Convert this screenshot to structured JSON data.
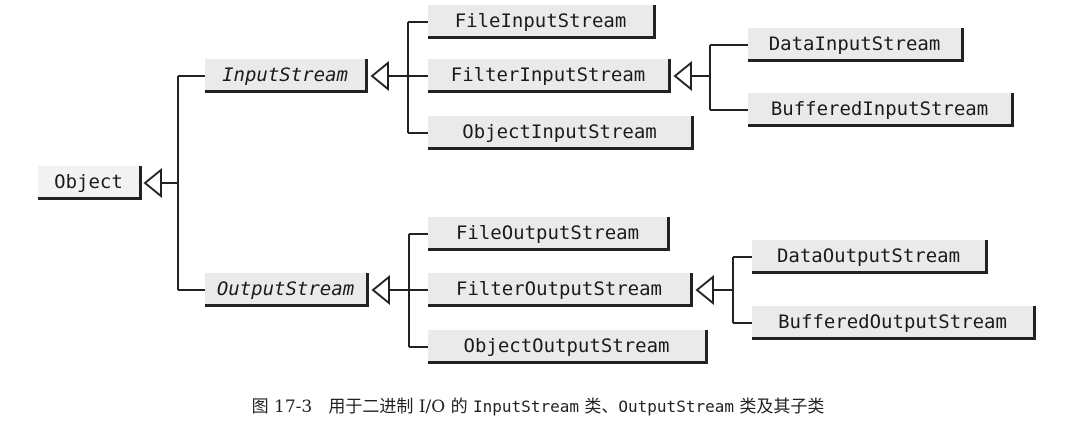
{
  "nodes": {
    "object": "Object",
    "input_stream": "InputStream",
    "output_stream": "OutputStream",
    "file_input_stream": "FileInputStream",
    "filter_input_stream": "FilterInputStream",
    "object_input_stream": "ObjectInputStream",
    "data_input_stream": "DataInputStream",
    "buffered_input_stream": "BufferedInputStream",
    "file_output_stream": "FileOutputStream",
    "filter_output_stream": "FilterOutputStream",
    "object_output_stream": "ObjectOutputStream",
    "data_output_stream": "DataOutputStream",
    "buffered_output_stream": "BufferedOutputStream"
  },
  "caption": {
    "fig": "图 17-3",
    "text_a": "用于二进制 I/O 的 ",
    "code_a": "InputStream",
    "text_b": " 类、",
    "code_b": "OutputStream",
    "text_c": " 类及其子类"
  }
}
